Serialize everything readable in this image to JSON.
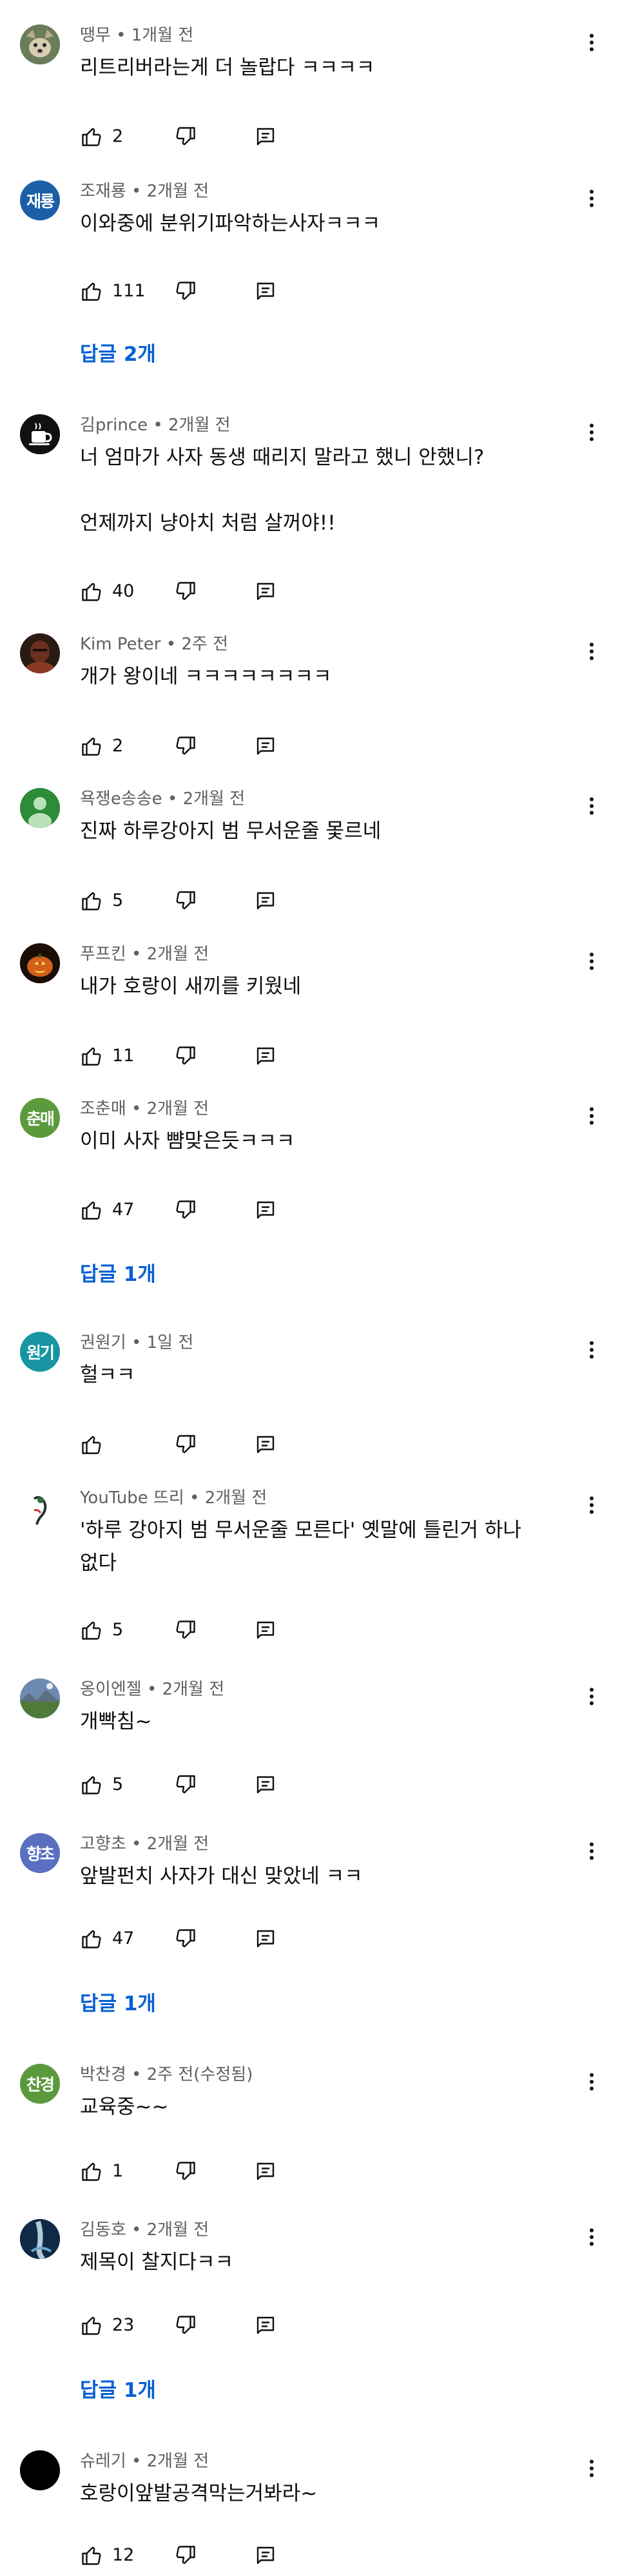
{
  "comments": [
    {
      "author": "땡무",
      "time": "1개월 전",
      "text": "리트리버라는게 더 놀랍다 ㅋㅋㅋㅋ",
      "likes": "2",
      "avatar": {
        "type": "photo-dog",
        "color": "#6a7d5a"
      }
    },
    {
      "author": "조재룡",
      "time": "2개월 전",
      "text": "이와중에 분위기파악하는사자ㅋㅋㅋ",
      "likes": "111",
      "avatar": {
        "type": "initials",
        "initials": "재룡",
        "color": "#1d5fa6"
      },
      "replies_label": "답글 2개"
    },
    {
      "author": "김prince",
      "time": "2개월 전",
      "text": "너 엄마가 사자 동생 때리지 말라고 했니 안했니?\n\n언제까지 냥아치 처럼 살꺼야!!",
      "likes": "40",
      "avatar": {
        "type": "photo-cup",
        "color": "#111111"
      }
    },
    {
      "author": "Kim Peter",
      "time": "2주 전",
      "text": "개가 왕이네 ㅋㅋㅋㅋㅋㅋㅋㅋ",
      "likes": "2",
      "avatar": {
        "type": "photo-person",
        "color": "#6b2f20"
      }
    },
    {
      "author": "욕쟁e송송e",
      "time": "2개월 전",
      "text": "진짜 하루강아지 범 무서운줄 몿르네",
      "likes": "5",
      "avatar": {
        "type": "default",
        "color": "#2e8b3a"
      }
    },
    {
      "author": "푸프킨",
      "time": "2개월 전",
      "text": "내가 호랑이 새끼를 키웠네",
      "likes": "11",
      "avatar": {
        "type": "photo-pumpkin",
        "color": "#1a0d05"
      }
    },
    {
      "author": "조춘매",
      "time": "2개월 전",
      "text": "이미 사자 뺨맞은듯ㅋㅋㅋ",
      "likes": "47",
      "avatar": {
        "type": "initials",
        "initials": "춘매",
        "color": "#5b9a3c"
      },
      "replies_label": "답글 1개"
    },
    {
      "author": "권원기",
      "time": "1일 전",
      "text": "헐ㅋㅋ",
      "likes": "",
      "avatar": {
        "type": "initials",
        "initials": "원기",
        "color": "#1795a3"
      }
    },
    {
      "author": "YouTube 뜨리",
      "time": "2개월 전",
      "text": "'하루 강아지 범 무서운줄 모른다' 옛말에 틀린거 하나\n없다",
      "likes": "5",
      "avatar": {
        "type": "photo-bird",
        "color": "#ffffff"
      }
    },
    {
      "author": "옹이엔젤",
      "time": "2개월 전",
      "text": "개빡침~",
      "likes": "5",
      "avatar": {
        "type": "photo-landscape",
        "color": "#6d8bb0"
      }
    },
    {
      "author": "고향초",
      "time": "2개월 전",
      "text": "앞발펀치 사자가 대신 맞았네 ㅋㅋ",
      "likes": "47",
      "avatar": {
        "type": "initials",
        "initials": "향초",
        "color": "#5a6fc0"
      },
      "replies_label": "답글 1개"
    },
    {
      "author": "박찬경",
      "time": "2주 전(수정됨)",
      "text": "교육중~~",
      "likes": "1",
      "avatar": {
        "type": "initials",
        "initials": "찬경",
        "color": "#5b9a3c"
      }
    },
    {
      "author": "김동호",
      "time": "2개월 전",
      "text": "제목이 찰지다ㅋㅋ",
      "likes": "23",
      "avatar": {
        "type": "photo-water",
        "color": "#0e2a45"
      },
      "replies_label": "답글 1개"
    },
    {
      "author": "슈레기",
      "time": "2개월 전",
      "text": "호랑이앞발공격막는거봐라~",
      "likes": "12",
      "avatar": {
        "type": "photo-black",
        "color": "#000000"
      }
    }
  ],
  "icons": {
    "like": "thumbs-up-icon",
    "dislike": "thumbs-down-icon",
    "reply": "reply-icon",
    "more": "more-vert-icon"
  },
  "colors": {
    "link": "#065fd4",
    "meta": "#606060",
    "text": "#0f0f0f"
  }
}
